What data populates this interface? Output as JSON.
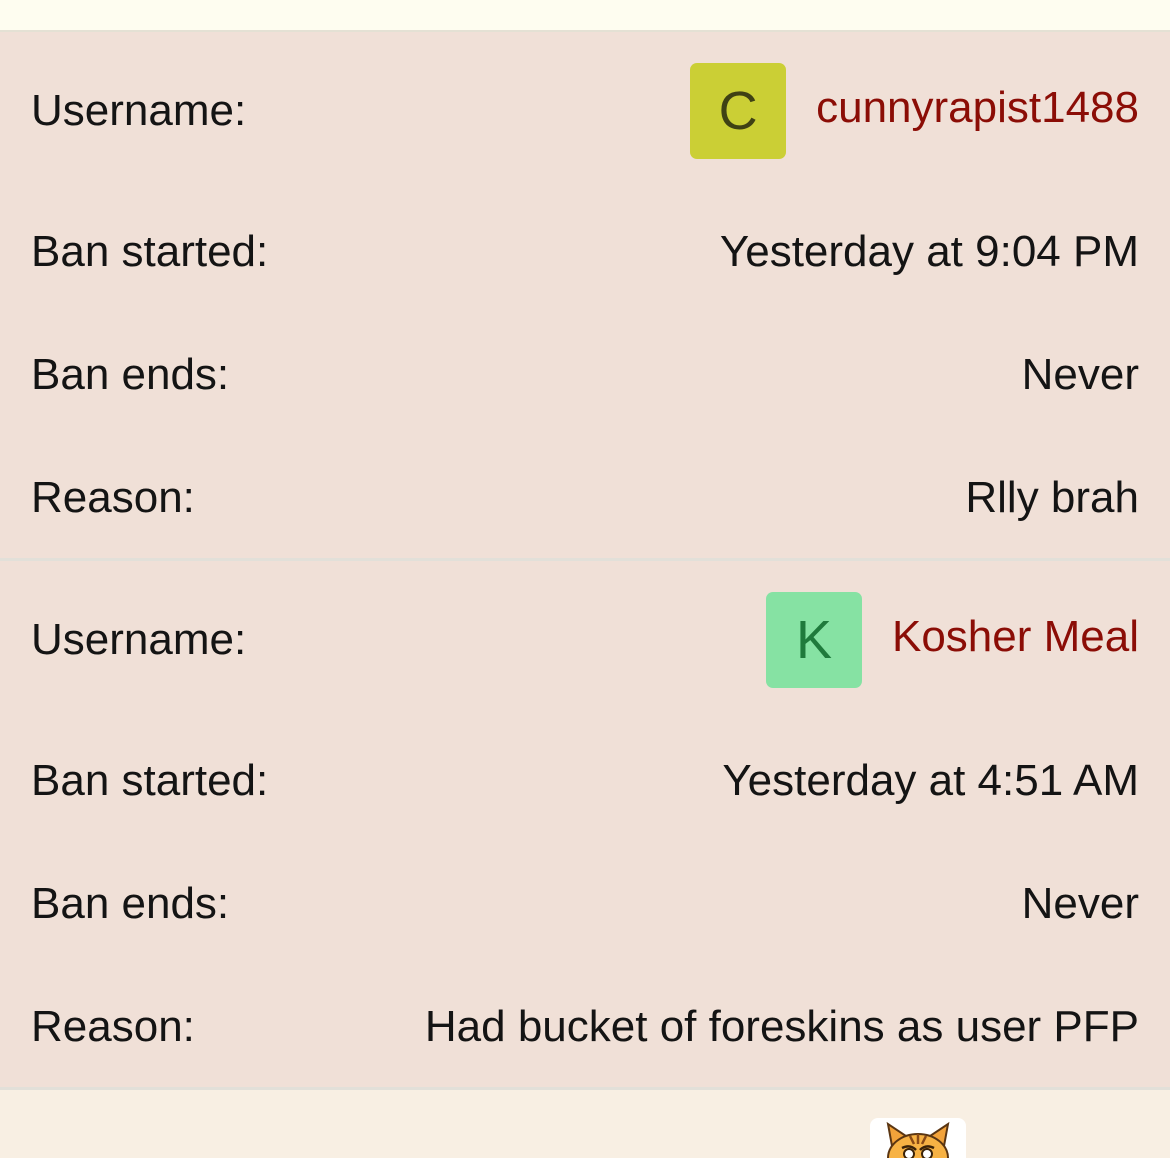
{
  "bans": [
    {
      "username_label": "Username:",
      "avatar_letter": "C",
      "avatar_bg": "#cbcf35",
      "avatar_fg": "#3f4114",
      "username": "cunnyrapist1488",
      "ban_started_label": "Ban started:",
      "ban_started": "Yesterday at 9:04 PM",
      "ban_ends_label": "Ban ends:",
      "ban_ends": "Never",
      "reason_label": "Reason:",
      "reason": "Rlly brah"
    },
    {
      "username_label": "Username:",
      "avatar_letter": "K",
      "avatar_bg": "#86e2a3",
      "avatar_fg": "#1f7a3c",
      "username": "Kosher Meal",
      "ban_started_label": "Ban started:",
      "ban_started": "Yesterday at 4:51 AM",
      "ban_ends_label": "Ban ends:",
      "ban_ends": "Never",
      "reason_label": "Reason:",
      "reason": "Had bucket of foreskins as user PFP"
    }
  ],
  "colors": {
    "card_bg": "#f0e0d7",
    "username_link": "#8b0d06",
    "page_bg": "#f8efe3"
  }
}
